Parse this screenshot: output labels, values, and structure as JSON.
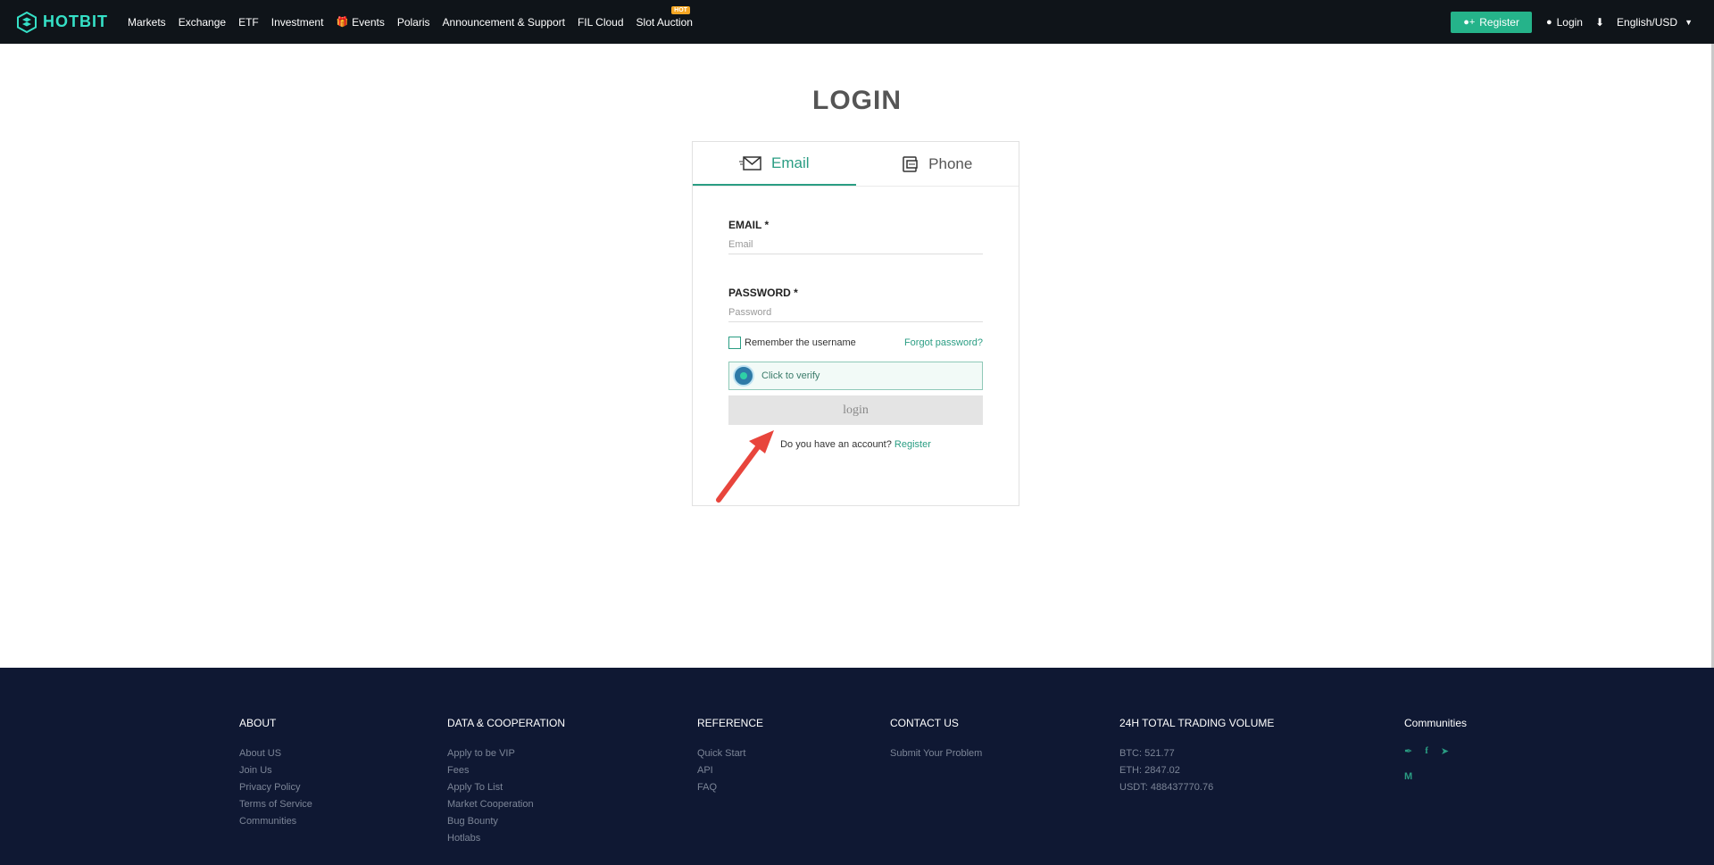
{
  "header": {
    "logo_text": "HOTBIT",
    "nav": [
      {
        "label": "Markets"
      },
      {
        "label": "Exchange"
      },
      {
        "label": "ETF"
      },
      {
        "label": "Investment"
      },
      {
        "label": "Events"
      },
      {
        "label": "Polaris"
      },
      {
        "label": "Announcement & Support"
      },
      {
        "label": "FIL Cloud"
      },
      {
        "label": "Slot Auction"
      }
    ],
    "hot_badge": "HOT",
    "register_label": "Register",
    "login_label": "Login",
    "language": "English/USD"
  },
  "login": {
    "title": "LOGIN",
    "tabs": [
      {
        "label": "Email"
      },
      {
        "label": "Phone"
      }
    ],
    "email_label": "EMAIL *",
    "email_placeholder": "Email",
    "password_label": "PASSWORD *",
    "password_placeholder": "Password",
    "remember_label": "Remember the username",
    "forgot_label": "Forgot password?",
    "verify_label": "Click to verify",
    "login_button": "login",
    "have_account_text": "Do you have an account?",
    "register_link": "Register"
  },
  "footer": {
    "about": {
      "title": "ABOUT",
      "links": [
        "About US",
        "Join Us",
        "Privacy Policy",
        "Terms of Service",
        "Communities"
      ]
    },
    "data": {
      "title": "DATA & COOPERATION",
      "links": [
        "Apply to be VIP",
        "Fees",
        "Apply To List",
        "Market Cooperation",
        "Bug Bounty",
        "Hotlabs"
      ]
    },
    "reference": {
      "title": "REFERENCE",
      "links": [
        "Quick Start",
        "API",
        "FAQ"
      ]
    },
    "contact": {
      "title": "CONTACT US",
      "links": [
        "Submit Your Problem"
      ]
    },
    "volume": {
      "title": "24H TOTAL TRADING VOLUME",
      "lines": [
        "BTC: 521.77",
        "ETH: 2847.02",
        "USDT: 488437770.76"
      ]
    },
    "communities": {
      "title": "Communities"
    }
  },
  "colors": {
    "header_bg": "#0f1419",
    "accent": "#2a9d83",
    "footer_bg": "#0f1833",
    "arrow": "#e8453c"
  }
}
